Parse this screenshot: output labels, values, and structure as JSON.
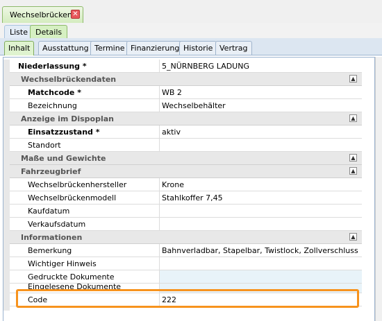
{
  "document_tab": {
    "label": "Wechselbrücken",
    "close_glyph": "✕"
  },
  "view_tabs": [
    {
      "label": "Liste",
      "active": false
    },
    {
      "label": "Details",
      "active": true
    }
  ],
  "sub_tabs": [
    {
      "label": "Inhalt",
      "active": true
    },
    {
      "label": "Ausstattung"
    },
    {
      "label": "Termine"
    },
    {
      "label": "Finanzierung"
    },
    {
      "label": "Historie"
    },
    {
      "label": "Vertrag"
    }
  ],
  "grid": {
    "niederlassung": {
      "name": "Niederlassung *",
      "value": "5_NÜRNBERG LADUNG"
    },
    "cat_wechselbrueckendaten": "Wechselbrückendaten",
    "matchcode": {
      "name": "Matchcode *",
      "value": "WB 2"
    },
    "bezeichnung": {
      "name": "Bezeichnung",
      "value": "Wechselbehälter"
    },
    "cat_dispoplan": "Anzeige im Dispoplan",
    "einsatzzustand": {
      "name": "Einsatzzustand *",
      "value": "aktiv"
    },
    "standort": {
      "name": "Standort",
      "value": ""
    },
    "cat_masse": "Maße und Gewichte",
    "cat_fahrzeugbrief": "Fahrzeugbrief",
    "hersteller": {
      "name": "Wechselbrückenhersteller",
      "value": "Krone"
    },
    "modell": {
      "name": "Wechselbrückenmodell",
      "value": "Stahlkoffer 7,45"
    },
    "kaufdatum": {
      "name": "Kaufdatum",
      "value": ""
    },
    "verkaufsdatum": {
      "name": "Verkaufsdatum",
      "value": ""
    },
    "cat_informationen": "Informationen",
    "bemerkung": {
      "name": "Bemerkung",
      "value": "Bahnverladbar, Stapelbar, Twistlock, Zollverschluss"
    },
    "hinweis": {
      "name": "Wichtiger Hinweis",
      "value": ""
    },
    "gedruckt": {
      "name": "Gedruckte Dokumente",
      "value": ""
    },
    "eingelesen": {
      "name": "Eingelesene Dokumente",
      "value": ""
    },
    "code": {
      "name": "Code",
      "value": "222"
    }
  },
  "collapse_glyph": "▲",
  "colors": {
    "highlight": "#f7931e",
    "active_tab": "#dff3cf",
    "category_bg": "#e8e8e8"
  }
}
